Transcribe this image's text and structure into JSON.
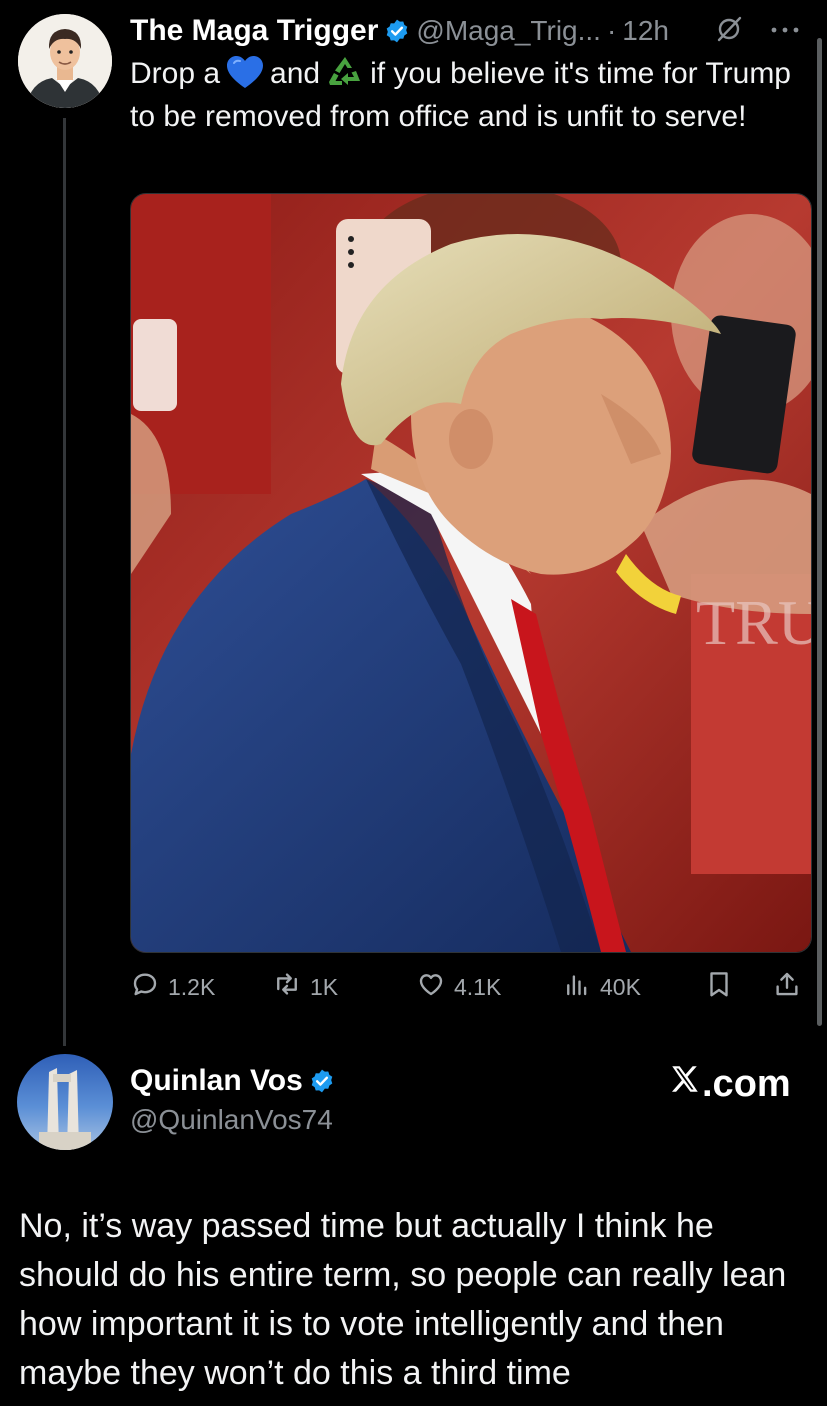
{
  "tweet": {
    "author_name": "The Maga Trigger",
    "handle": "@Maga_Trig...",
    "separator": "·",
    "time": "12h",
    "text_part1": "Drop a",
    "text_part2": "and",
    "text_part3": "if you believe it's time for Trump to be removed from office and is unfit to serve!",
    "emoji1": "blue-heart",
    "emoji2": "recycle-symbol",
    "image_alt": "Man in navy suit and red tie walking past a crowd holding phones",
    "stats": {
      "replies": "1.2K",
      "reposts": "1K",
      "likes": "4.1K",
      "views": "40K"
    }
  },
  "reply": {
    "author_name": "Quinlan Vos",
    "handle": "@QuinlanVos74",
    "source": ".com",
    "text": "No, it’s way passed time but actually I think he should do his entire term, so people can really lean how important it is to vote intelligently and then maybe they won’t do this a third time"
  },
  "colors": {
    "background": "#000000",
    "verified": "#1d9bf0",
    "muted_text": "#8b9096"
  }
}
